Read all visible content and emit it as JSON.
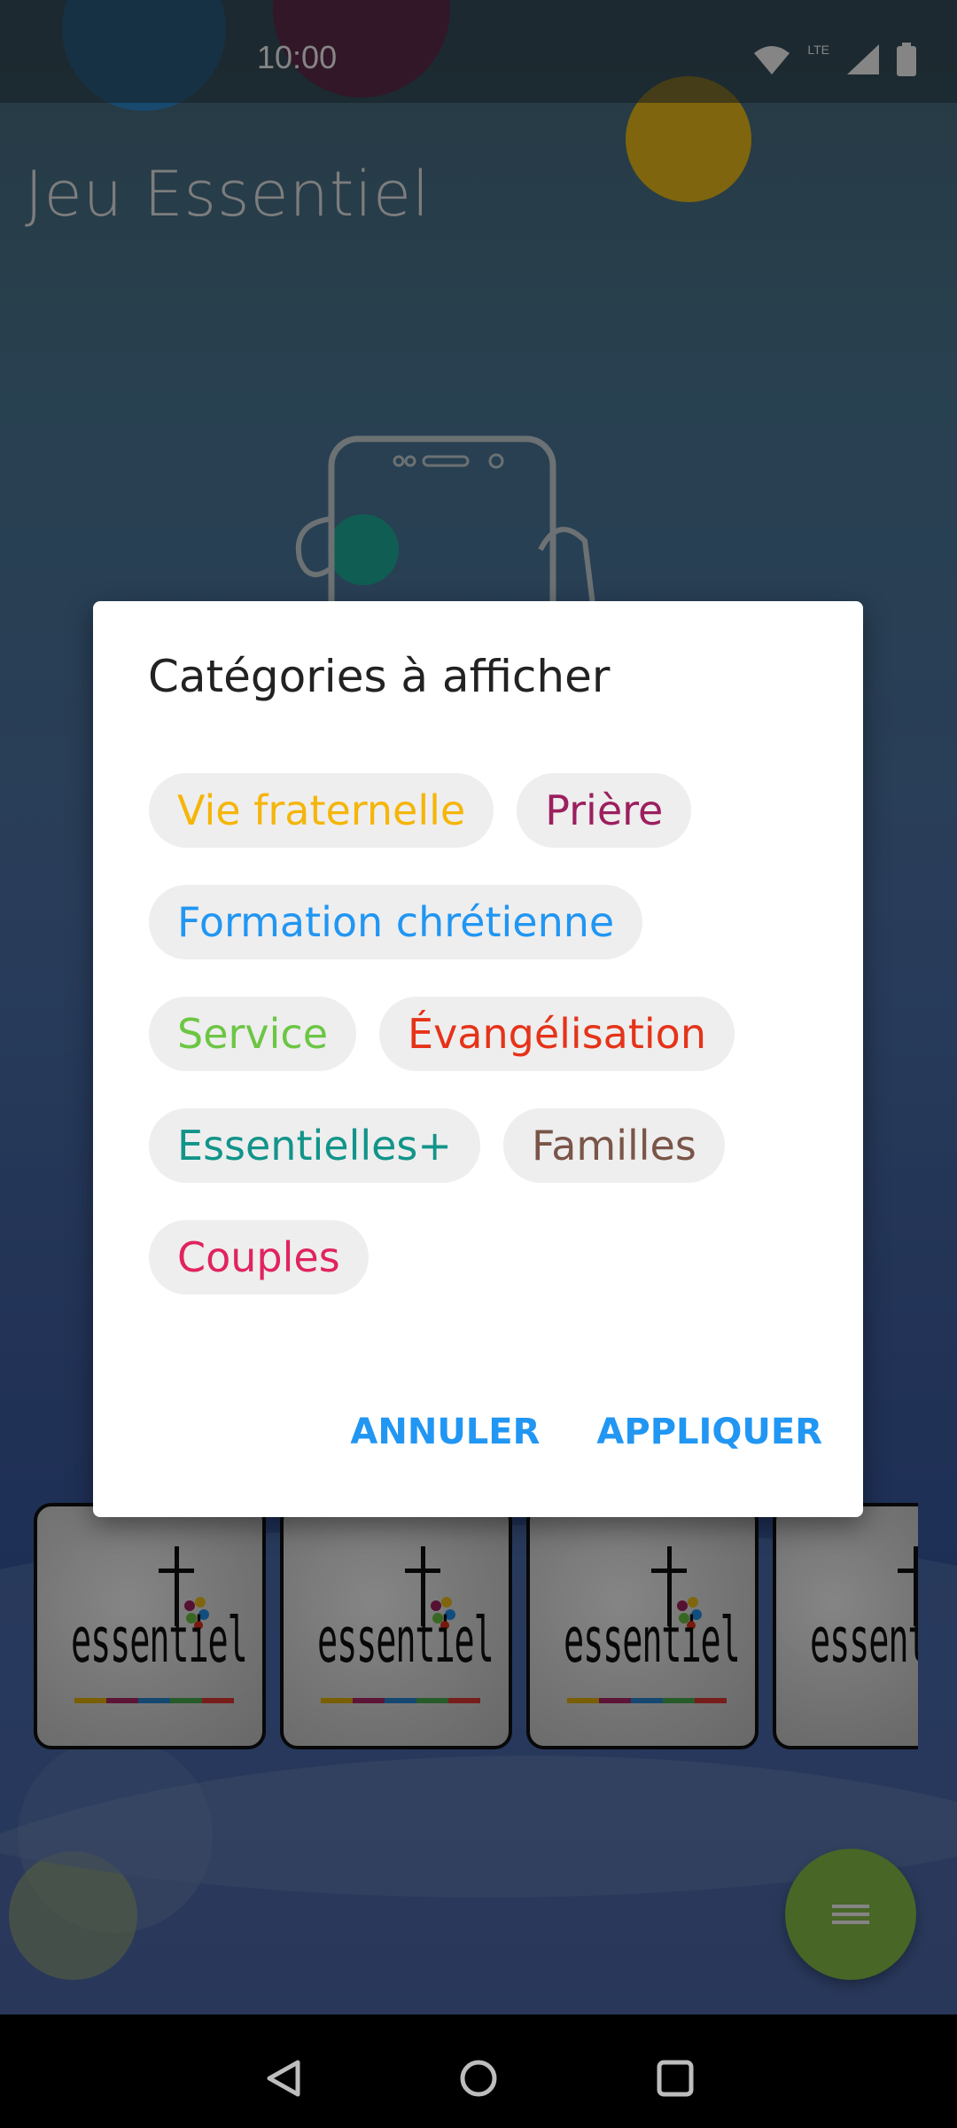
{
  "status_bar": {
    "time": "10:00",
    "network_label": "LTE"
  },
  "app": {
    "title": "Jeu Essentiel",
    "fab_icon": "menu-icon"
  },
  "cards": [
    {
      "logo_text": "essentiel"
    },
    {
      "logo_text": "essentiel"
    },
    {
      "logo_text": "essentiel"
    },
    {
      "logo_text": "essentiel"
    }
  ],
  "dialog": {
    "title": "Catégories à afficher",
    "chips": [
      {
        "label": "Vie fraternelle",
        "color": "#f5b50a"
      },
      {
        "label": "Prière",
        "color": "#9c1f5e"
      },
      {
        "label": "Formation chrétienne",
        "color": "#2196f3"
      },
      {
        "label": "Service",
        "color": "#6cc644"
      },
      {
        "label": "Évangélisation",
        "color": "#e53319"
      },
      {
        "label": "Essentielles+",
        "color": "#12948a"
      },
      {
        "label": "Familles",
        "color": "#7a5548"
      },
      {
        "label": "Couples",
        "color": "#e0245e"
      }
    ],
    "cancel_label": "ANNULER",
    "apply_label": "APPLIQUER",
    "action_color": "#2196f3"
  },
  "nav": {
    "back_icon": "back-icon",
    "home_icon": "home-icon",
    "recents_icon": "recents-icon"
  }
}
